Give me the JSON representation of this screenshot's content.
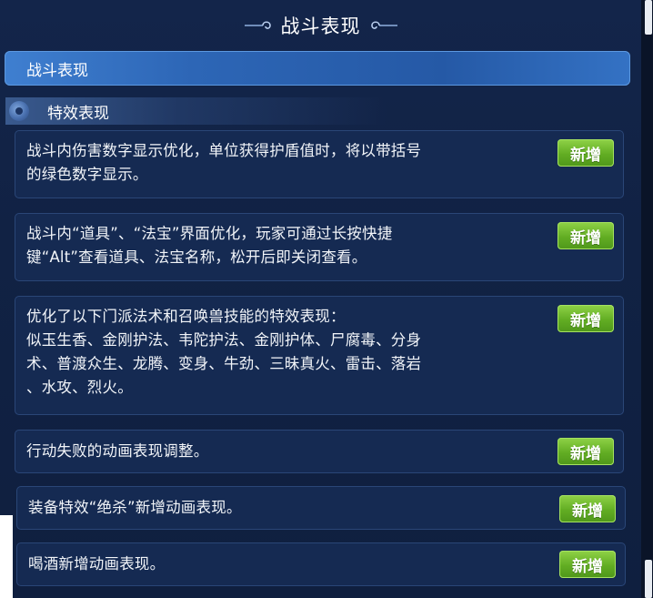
{
  "title": "战斗表现",
  "section": {
    "label": "战斗表现"
  },
  "subsection": {
    "label": "特效表现"
  },
  "items": [
    {
      "lines": [
        "战斗内伤害数字显示优化，单位获得护盾值时，将以带括号",
        "的绿色数字显示。"
      ],
      "badge": "新增"
    },
    {
      "lines": [
        "战斗内“道具”、“法宝”界面优化，玩家可通过长按快捷",
        "键“Alt”查看道具、法宝名称，松开后即关闭查看。"
      ],
      "badge": "新增"
    },
    {
      "lines": [
        "优化了以下门派法术和召唤兽技能的特效表现：",
        "似玉生香、金刚护法、韦陀护法、金刚护体、尸腐毒、分身",
        "术、普渡众生、龙腾、变身、牛劲、三昧真火、雷击、落岩",
        "、水攻、烈火。"
      ],
      "badge": "新增"
    },
    {
      "lines": [
        "行动失败的动画表现调整。"
      ],
      "badge": "新增"
    },
    {
      "lines": [
        "装备特效“绝杀”新增动画表现。"
      ],
      "badge": "新增"
    },
    {
      "lines": [
        "喝酒新增动画表现。"
      ],
      "badge": "新增"
    }
  ],
  "colors": {
    "badge_green": "#62ad23",
    "section_blue": "#2d66b6",
    "card_bg": "#152a52"
  }
}
